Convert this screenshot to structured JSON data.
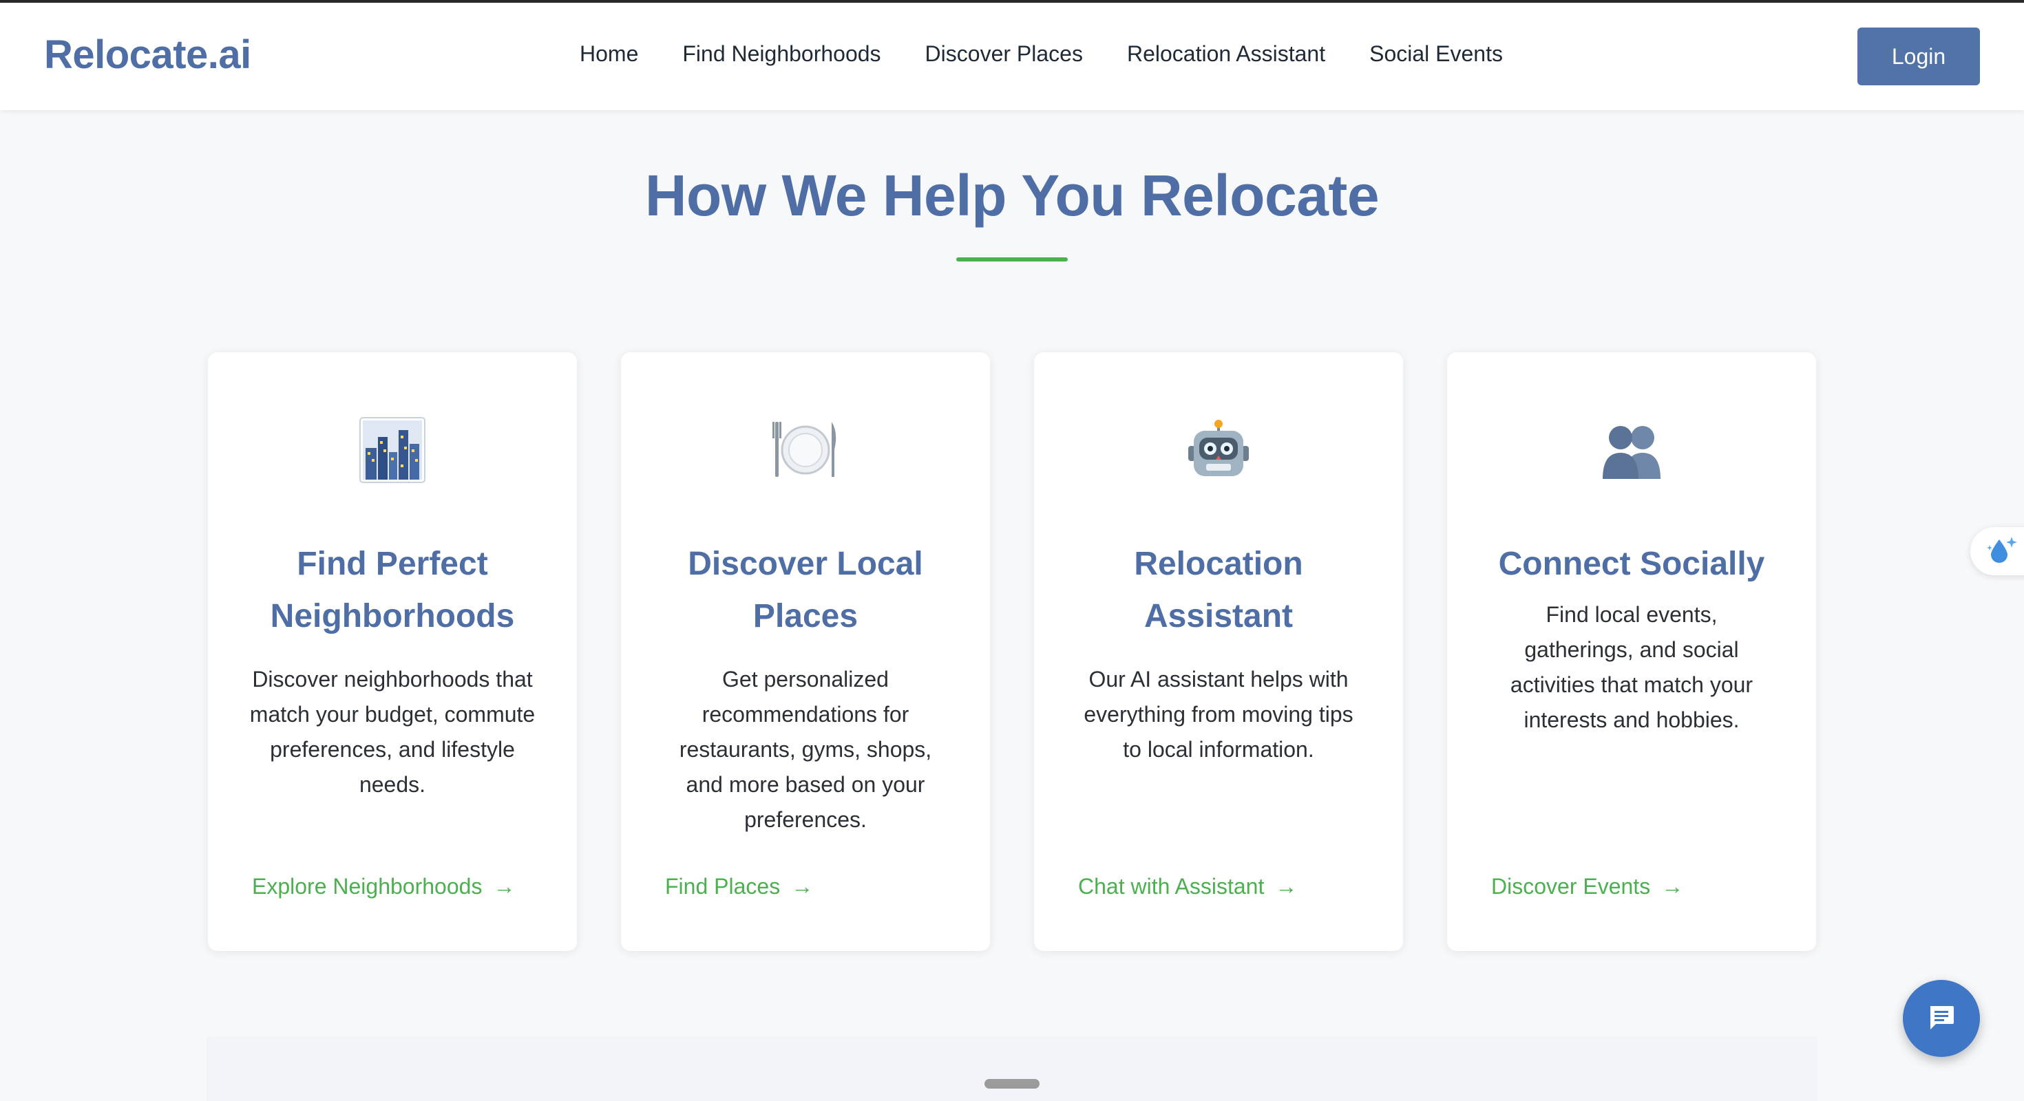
{
  "header": {
    "brand": "Relocate.ai",
    "nav": [
      "Home",
      "Find Neighborhoods",
      "Discover Places",
      "Relocation Assistant",
      "Social Events"
    ],
    "login_label": "Login"
  },
  "section": {
    "title": "How We Help You Relocate",
    "accent_color": "#4caf50",
    "brand_color": "#4e6ea5"
  },
  "cards": [
    {
      "icon": "cityscape-icon",
      "title": "Find Perfect Neighborhoods",
      "description": "Discover neighborhoods that match your budget, commute preferences, and lifestyle needs.",
      "cta": "Explore Neighborhoods"
    },
    {
      "icon": "plate-fork-knife-icon",
      "title": "Discover Local Places",
      "description": "Get personalized recommendations for restaurants, gyms, shops, and more based on your preferences.",
      "cta": "Find Places"
    },
    {
      "icon": "robot-icon",
      "title": "Relocation Assistant",
      "description": "Our AI assistant helps with everything from moving tips to local information.",
      "cta": "Chat with Assistant"
    },
    {
      "icon": "people-icon",
      "title": "Connect Socially",
      "description": "Find local events, gatherings, and social activities that match your interests and hobbies.",
      "cta": "Discover Events"
    }
  ],
  "widgets": {
    "side_widget_icon": "droplet-sparkle-icon",
    "chat_fab_icon": "chat-bubble-icon"
  }
}
